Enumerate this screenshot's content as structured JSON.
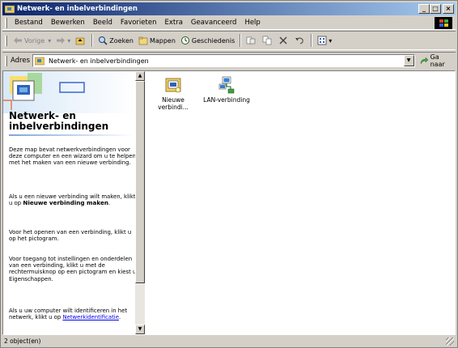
{
  "window": {
    "title": "Netwerk- en inbelverbindingen",
    "controls": {
      "minimize": "_",
      "maximize": "□",
      "close": "×"
    }
  },
  "menubar": {
    "items": [
      "Bestand",
      "Bewerken",
      "Beeld",
      "Favorieten",
      "Extra",
      "Geavanceerd",
      "Help"
    ]
  },
  "toolbar": {
    "back": "Vorige",
    "search": "Zoeken",
    "folders": "Mappen",
    "history": "Geschiedenis"
  },
  "addressbar": {
    "label": "Adres",
    "value": "Netwerk- en inbelverbindingen",
    "go": "Ga naar"
  },
  "left_pane": {
    "title": "Netwerk- en inbelverbindingen",
    "para1": "Deze map bevat netwerkverbindingen voor deze computer en een wizard om u te helpen met het maken van een nieuwe verbinding.",
    "para2_pre": "Als u een nieuwe verbinding wilt maken, klikt u op ",
    "para2_bold": "Nieuwe verbinding maken",
    "para2_post": ".",
    "para3": "Voor het openen van een verbinding, klikt u op het pictogram.",
    "para4": "Voor toegang tot instellingen en onderdelen van een verbinding, klikt u met de rechtermuisknop op een pictogram en kiest u Eigenschappen.",
    "para5_pre": "Als u uw computer wilt identificeren in het netwerk, klikt u op ",
    "para5_link": "Netwerkidentificatie",
    "para5_post": "."
  },
  "files": [
    {
      "label": "Nieuwe verbindi...",
      "icon": "new-connection-icon"
    },
    {
      "label": "LAN-verbinding",
      "icon": "lan-connection-icon"
    }
  ],
  "statusbar": {
    "text": "2 object(en)"
  },
  "colors": {
    "title_start": "#0a246a",
    "title_end": "#a6caf0",
    "face": "#d4d0c8",
    "link": "#0000ee"
  }
}
